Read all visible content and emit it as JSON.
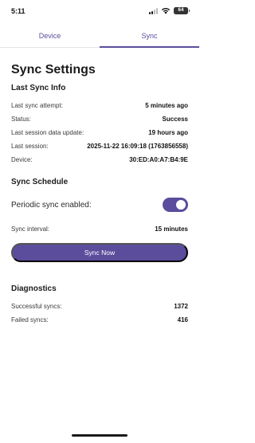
{
  "status_bar": {
    "time": "5:11",
    "battery": "64"
  },
  "tabs": [
    {
      "label": "Device",
      "active": false
    },
    {
      "label": "Sync",
      "active": true
    }
  ],
  "page": {
    "title": "Sync Settings"
  },
  "last_sync_info": {
    "title": "Last Sync Info",
    "rows": [
      {
        "label": "Last sync attempt:",
        "value": "5 minutes ago"
      },
      {
        "label": "Status:",
        "value": "Success"
      },
      {
        "label": "Last session data update:",
        "value": "19 hours ago"
      },
      {
        "label": "Last session:",
        "value": "2025-11-22 16:09:18 (1763856558)"
      },
      {
        "label": "Device:",
        "value": "30:ED:A0:A7:B4:9E"
      }
    ]
  },
  "sync_schedule": {
    "title": "Sync Schedule",
    "periodic_label": "Periodic sync enabled:",
    "periodic_enabled": true,
    "interval_label": "Sync interval:",
    "interval_value": "15 minutes",
    "sync_now_label": "Sync Now"
  },
  "diagnostics": {
    "title": "Diagnostics",
    "rows": [
      {
        "label": "Successful syncs:",
        "value": "1372"
      },
      {
        "label": "Failed syncs:",
        "value": "416"
      }
    ]
  },
  "colors": {
    "accent": "#5b4d9c",
    "background": "#ffffff"
  }
}
